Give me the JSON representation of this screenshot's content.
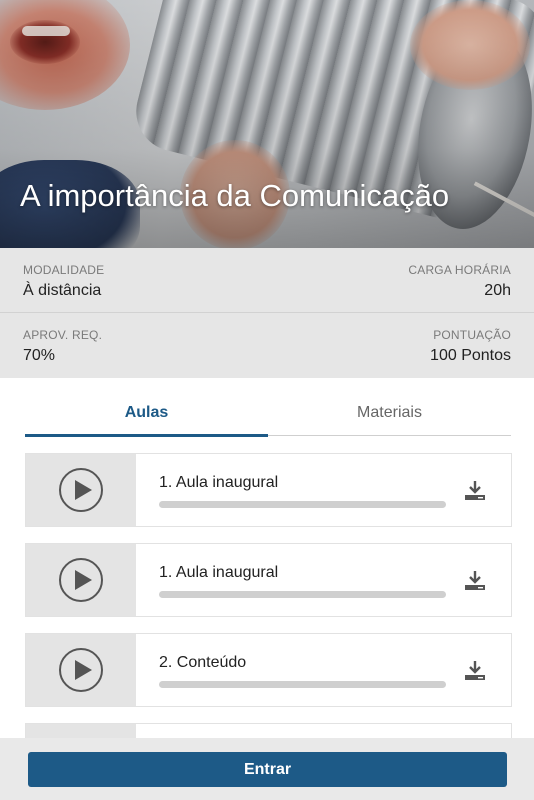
{
  "course": {
    "title": "A importância da Comunicação"
  },
  "info": {
    "modalidade": {
      "label": "MODALIDADE",
      "value": "À distância"
    },
    "carga_horaria": {
      "label": "CARGA HORÁRIA",
      "value": "20h"
    },
    "aprov_req": {
      "label": "APROV. REQ.",
      "value": "70%"
    },
    "pontuacao": {
      "label": "PONTUAÇÃO",
      "value": "100 Pontos"
    }
  },
  "tabs": [
    {
      "label": "Aulas",
      "active": true
    },
    {
      "label": "Materiais",
      "active": false
    }
  ],
  "lessons": [
    {
      "title": "1. Aula inaugural",
      "progress": 0
    },
    {
      "title": "1. Aula inaugural",
      "progress": 0
    },
    {
      "title": "2. Conteúdo",
      "progress": 0
    },
    {
      "title": "",
      "progress": 0
    }
  ],
  "footer": {
    "enter_label": "Entrar"
  },
  "colors": {
    "accent": "#1d5a87",
    "info_bg": "#e6e6e6",
    "thumb_bg": "#e4e4e4"
  },
  "icons": {
    "play": "play-circle-icon",
    "download": "download-icon"
  }
}
